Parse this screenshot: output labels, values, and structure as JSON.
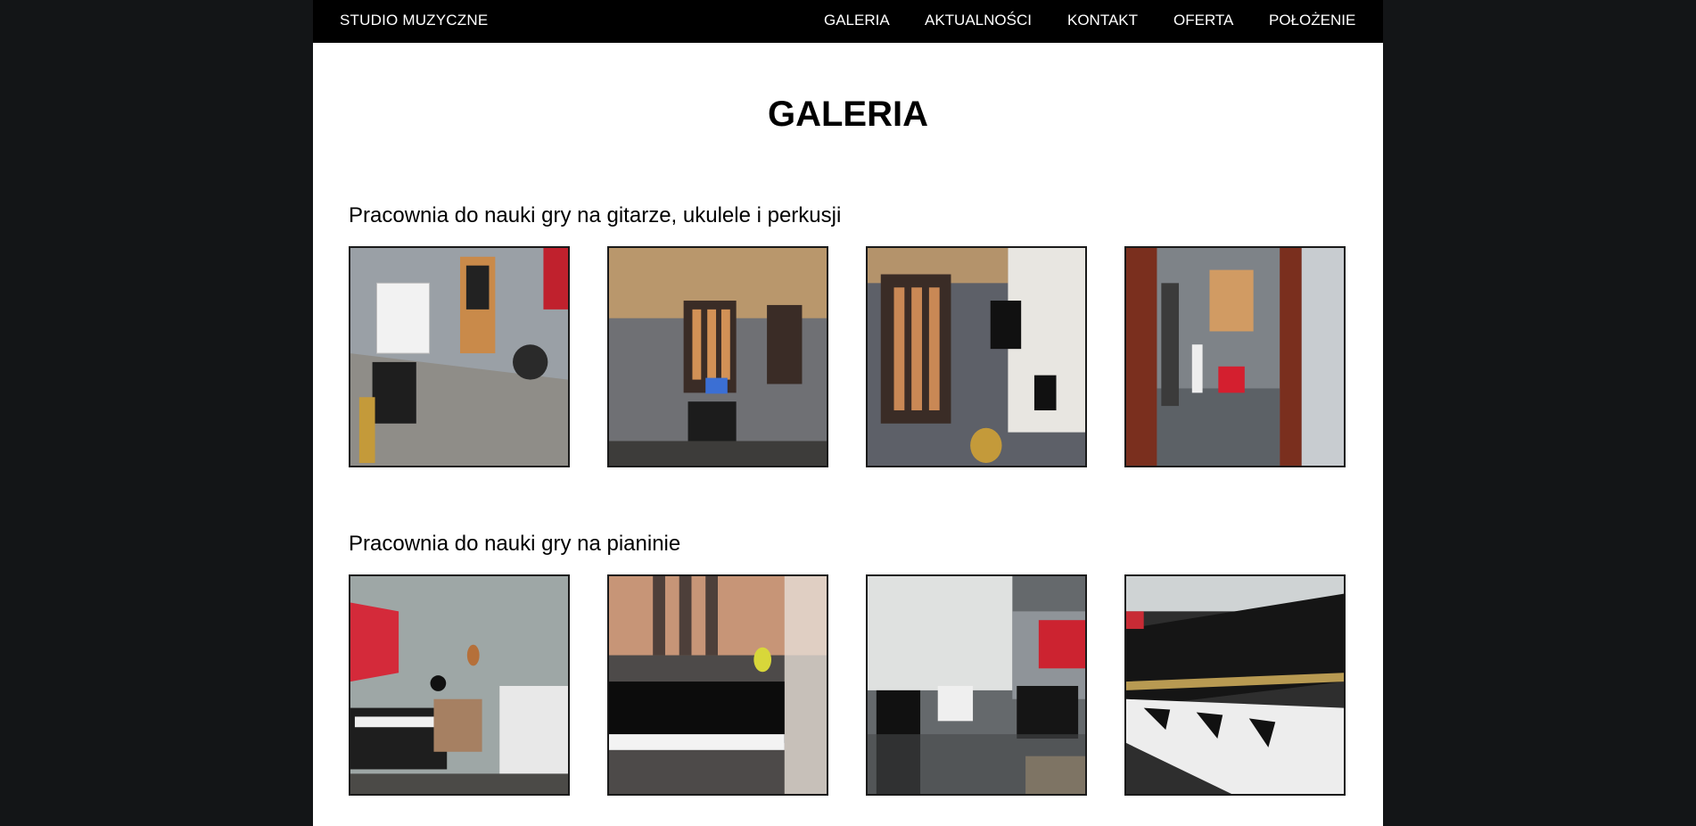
{
  "brand": "STUDIO MUZYCZNE",
  "nav": [
    {
      "label": "GALERIA"
    },
    {
      "label": "AKTUALNOŚCI"
    },
    {
      "label": "KONTAKT"
    },
    {
      "label": "OFERTA"
    },
    {
      "label": "POŁOŻENIE"
    }
  ],
  "page_title": "GALERIA",
  "sections": [
    {
      "title": "Pracownia do nauki gry na gitarze, ukulele i perkusji",
      "photos": 4
    },
    {
      "title": "Pracownia do nauki gry na pianinie",
      "photos": 4
    }
  ],
  "colors": {
    "outer_background": "#131517",
    "page_background": "#ffffff",
    "topbar": "#000000",
    "text": "#000000"
  }
}
